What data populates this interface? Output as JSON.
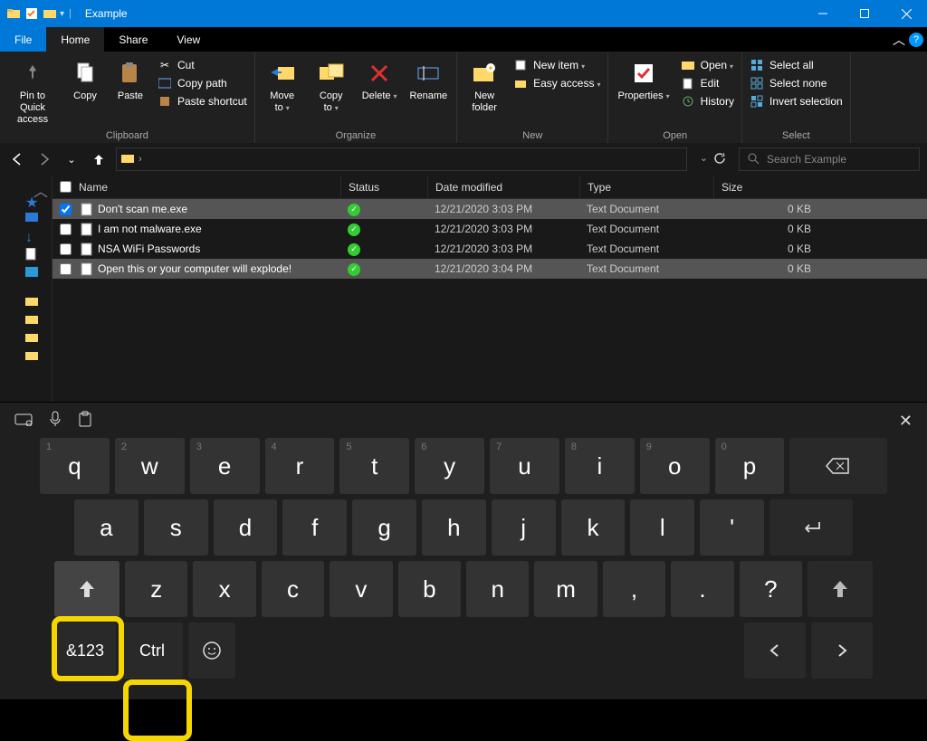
{
  "title": "Example",
  "tabs": {
    "file": "File",
    "home": "Home",
    "share": "Share",
    "view": "View"
  },
  "ribbon": {
    "clipboard": {
      "group": "Clipboard",
      "pin": "Pin to Quick access",
      "copy": "Copy",
      "paste": "Paste",
      "cut": "Cut",
      "copypath": "Copy path",
      "pasteshortcut": "Paste shortcut"
    },
    "organize": {
      "group": "Organize",
      "moveto": "Move to",
      "copyto": "Copy to",
      "delete": "Delete",
      "rename": "Rename"
    },
    "new": {
      "group": "New",
      "newfolder": "New folder",
      "newitem": "New item",
      "easyaccess": "Easy access"
    },
    "open": {
      "group": "Open",
      "properties": "Properties",
      "open": "Open",
      "edit": "Edit",
      "history": "History"
    },
    "select": {
      "group": "Select",
      "all": "Select all",
      "none": "Select none",
      "invert": "Invert selection"
    }
  },
  "search": {
    "placeholder": "Search Example"
  },
  "columns": {
    "name": "Name",
    "status": "Status",
    "date": "Date modified",
    "type": "Type",
    "size": "Size"
  },
  "rows": [
    {
      "name": "Don't scan me.exe",
      "date": "12/21/2020 3:03 PM",
      "type": "Text Document",
      "size": "0 KB",
      "checked": true,
      "sel": true
    },
    {
      "name": "I am not malware.exe",
      "date": "12/21/2020 3:03 PM",
      "type": "Text Document",
      "size": "0 KB",
      "checked": false,
      "sel": false
    },
    {
      "name": "NSA WiFi Passwords",
      "date": "12/21/2020 3:03 PM",
      "type": "Text Document",
      "size": "0 KB",
      "checked": false,
      "sel": false
    },
    {
      "name": "Open this or your computer will explode!",
      "date": "12/21/2020 3:04 PM",
      "type": "Text Document",
      "size": "0 KB",
      "checked": false,
      "sel": true
    }
  ],
  "keyboard": {
    "row1": [
      {
        "num": "1",
        "key": "q"
      },
      {
        "num": "2",
        "key": "w"
      },
      {
        "num": "3",
        "key": "e"
      },
      {
        "num": "4",
        "key": "r"
      },
      {
        "num": "5",
        "key": "t"
      },
      {
        "num": "6",
        "key": "y"
      },
      {
        "num": "7",
        "key": "u"
      },
      {
        "num": "8",
        "key": "i"
      },
      {
        "num": "9",
        "key": "o"
      },
      {
        "num": "0",
        "key": "p"
      }
    ],
    "row2": [
      "a",
      "s",
      "d",
      "f",
      "g",
      "h",
      "j",
      "k",
      "l",
      "'"
    ],
    "row3": [
      "z",
      "x",
      "c",
      "v",
      "b",
      "n",
      "m",
      ",",
      ".",
      "?"
    ],
    "fn": {
      "numsym": "&123",
      "ctrl": "Ctrl"
    }
  }
}
